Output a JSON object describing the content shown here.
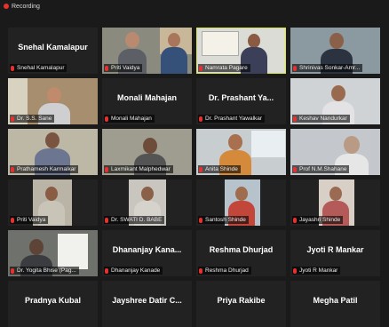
{
  "recording": {
    "label": "Recording",
    "color": "#e5312f"
  },
  "participants": [
    {
      "display_name": "Snehal Kamalapur",
      "label": "Snehal Kamalapur",
      "video": false
    },
    {
      "label": "Priti Vaidya",
      "video": true
    },
    {
      "label": "Namrata Pagare",
      "video": true,
      "active_speaker": true
    },
    {
      "label": "Shrinivas Sonkar-Amr...",
      "video": true
    },
    {
      "label": "Dr. S.S. Sane",
      "video": true
    },
    {
      "display_name": "Monali Mahajan",
      "label": "Monali Mahajan",
      "video": false
    },
    {
      "display_name": "Dr. Prashant Ya...",
      "label": "Dr. Prashant Yawalkar",
      "video": false
    },
    {
      "label": "Keshav Nandurkar",
      "video": true
    },
    {
      "label": "Prathamesh Karmalkar",
      "video": true
    },
    {
      "label": "Laxmikant Malphedwar",
      "video": true
    },
    {
      "label": "Anita Shinde",
      "video": true
    },
    {
      "label": "Prof N.M.Shahane",
      "video": true
    },
    {
      "label": "Priti Vaidya",
      "video": true
    },
    {
      "label": "Dr. SWATI D. BABE",
      "video": true
    },
    {
      "label": "Santosh Shinde",
      "video": true
    },
    {
      "label": "Jayashri Shinde",
      "video": true
    },
    {
      "label": "Dr. Yogita Bhise (Pag...",
      "video": true
    },
    {
      "display_name": "Dhananjay Kana...",
      "label": "Dhananjay Kanade",
      "video": false
    },
    {
      "display_name": "Reshma Dhurjad",
      "label": "Reshma Dhurjad",
      "video": false
    },
    {
      "display_name": "Jyoti R Mankar",
      "label": "Jyoti R Mankar",
      "video": false
    },
    {
      "display_name": "Pradnya Kubal",
      "video": false
    },
    {
      "display_name": "Jayshree Datir C...",
      "video": false
    },
    {
      "display_name": "Priya Rakibe",
      "video": false
    },
    {
      "display_name": "Megha Patil",
      "video": false
    }
  ]
}
